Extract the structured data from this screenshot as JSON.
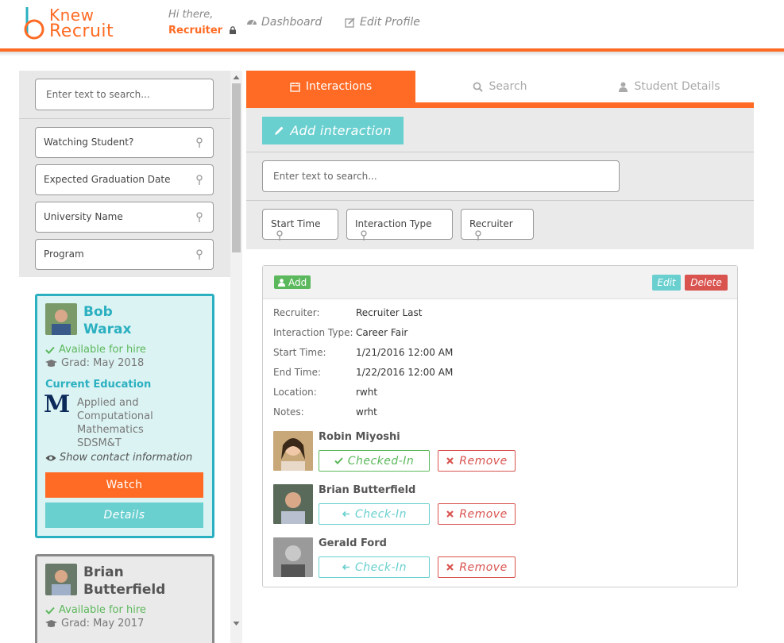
{
  "brand": {
    "line1": "Knew",
    "line2": "Recruit"
  },
  "header": {
    "greeting": "Hi there,",
    "role": "Recruiter",
    "nav": [
      {
        "label": "Dashboard"
      },
      {
        "label": "Edit Profile"
      }
    ]
  },
  "sidebar": {
    "search_placeholder": "Enter text to search...",
    "filters": [
      "Watching Student?",
      "Expected Graduation Date",
      "University Name",
      "Program"
    ],
    "students": [
      {
        "first_name": "Bob",
        "last_name": "Warax",
        "availability": "Available for hire",
        "grad": "Grad: May 2018",
        "education_heading": "Current Education",
        "program": "Applied and Computational Mathematics",
        "school": "SDSM&T",
        "contact": "Show contact information",
        "watch_label": "Watch",
        "details_label": "Details"
      },
      {
        "first_name": "Brian",
        "last_name": "Butterfield",
        "availability": "Available for hire",
        "grad": "Grad: May 2017"
      }
    ]
  },
  "tabs": [
    {
      "label": "Interactions",
      "active": true
    },
    {
      "label": "Search"
    },
    {
      "label": "Student Details"
    }
  ],
  "toolbar": {
    "add_interaction_label": "Add interaction",
    "search_placeholder": "Enter text to search...",
    "filters": [
      "Start Time",
      "Interaction Type",
      "Recruiter"
    ]
  },
  "interaction": {
    "add_label": "Add",
    "edit_label": "Edit",
    "delete_label": "Delete",
    "fields": [
      {
        "key": "Recruiter:",
        "value": "Recruiter Last"
      },
      {
        "key": "Interaction Type:",
        "value": "Career Fair"
      },
      {
        "key": "Start Time:",
        "value": "1/21/2016 12:00 AM"
      },
      {
        "key": "End Time:",
        "value": "1/22/2016 12:00 AM"
      },
      {
        "key": "Location:",
        "value": "rwht"
      },
      {
        "key": "Notes:",
        "value": "wrht"
      }
    ],
    "attendees": [
      {
        "name": "Robin Miyoshi",
        "status_label": "Checked-In",
        "remove_label": "Remove"
      },
      {
        "name": "Brian Butterfield",
        "status_label": "Check-In",
        "remove_label": "Remove"
      },
      {
        "name": "Gerald Ford",
        "status_label": "Check-In",
        "remove_label": "Remove"
      }
    ]
  },
  "colors": {
    "brand": "#ff6b24",
    "teal": "#6acfcf",
    "success": "#5cb85c",
    "danger": "#d9534f",
    "card_border": "#2ab0c0"
  }
}
